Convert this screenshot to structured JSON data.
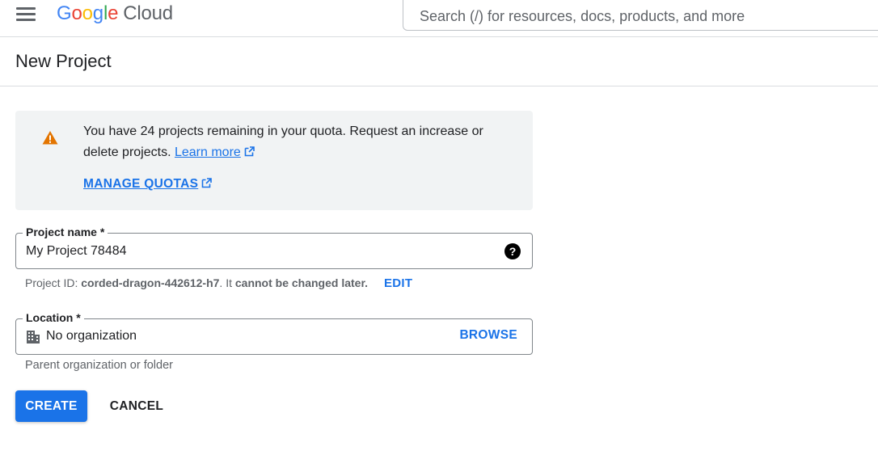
{
  "header": {
    "logo": {
      "g1": "G",
      "o1": "o",
      "o2": "o",
      "g2": "g",
      "l": "l",
      "e": "e",
      "cloud": "Cloud"
    },
    "search_placeholder": "Search (/) for resources, docs, products, and more"
  },
  "page": {
    "title": "New Project"
  },
  "quota_banner": {
    "message": "You have 24 projects remaining in your quota. Request an increase or delete projects.",
    "learn_more": "Learn more",
    "manage_quotas": "MANAGE QUOTAS"
  },
  "project_name": {
    "label": "Project name *",
    "value": "My Project 78484",
    "help_icon": "?"
  },
  "project_id": {
    "prefix": "Project ID: ",
    "id": "corded-dragon-442612-h7",
    "middle": ". It ",
    "note": "cannot be changed later.",
    "edit_label": "EDIT"
  },
  "location": {
    "label": "Location *",
    "value": "No organization",
    "browse_label": "BROWSE",
    "hint": "Parent organization or folder"
  },
  "actions": {
    "create_label": "CREATE",
    "cancel_label": "CANCEL"
  },
  "icons": {
    "menu": "hamburger-menu-icon",
    "warning": "warning-icon",
    "external": "external-link-icon",
    "help": "help-icon",
    "organization": "building-icon"
  },
  "colors": {
    "accent": "#1a73e8",
    "warning": "#e37400",
    "banner_bg": "#f1f3f4"
  }
}
